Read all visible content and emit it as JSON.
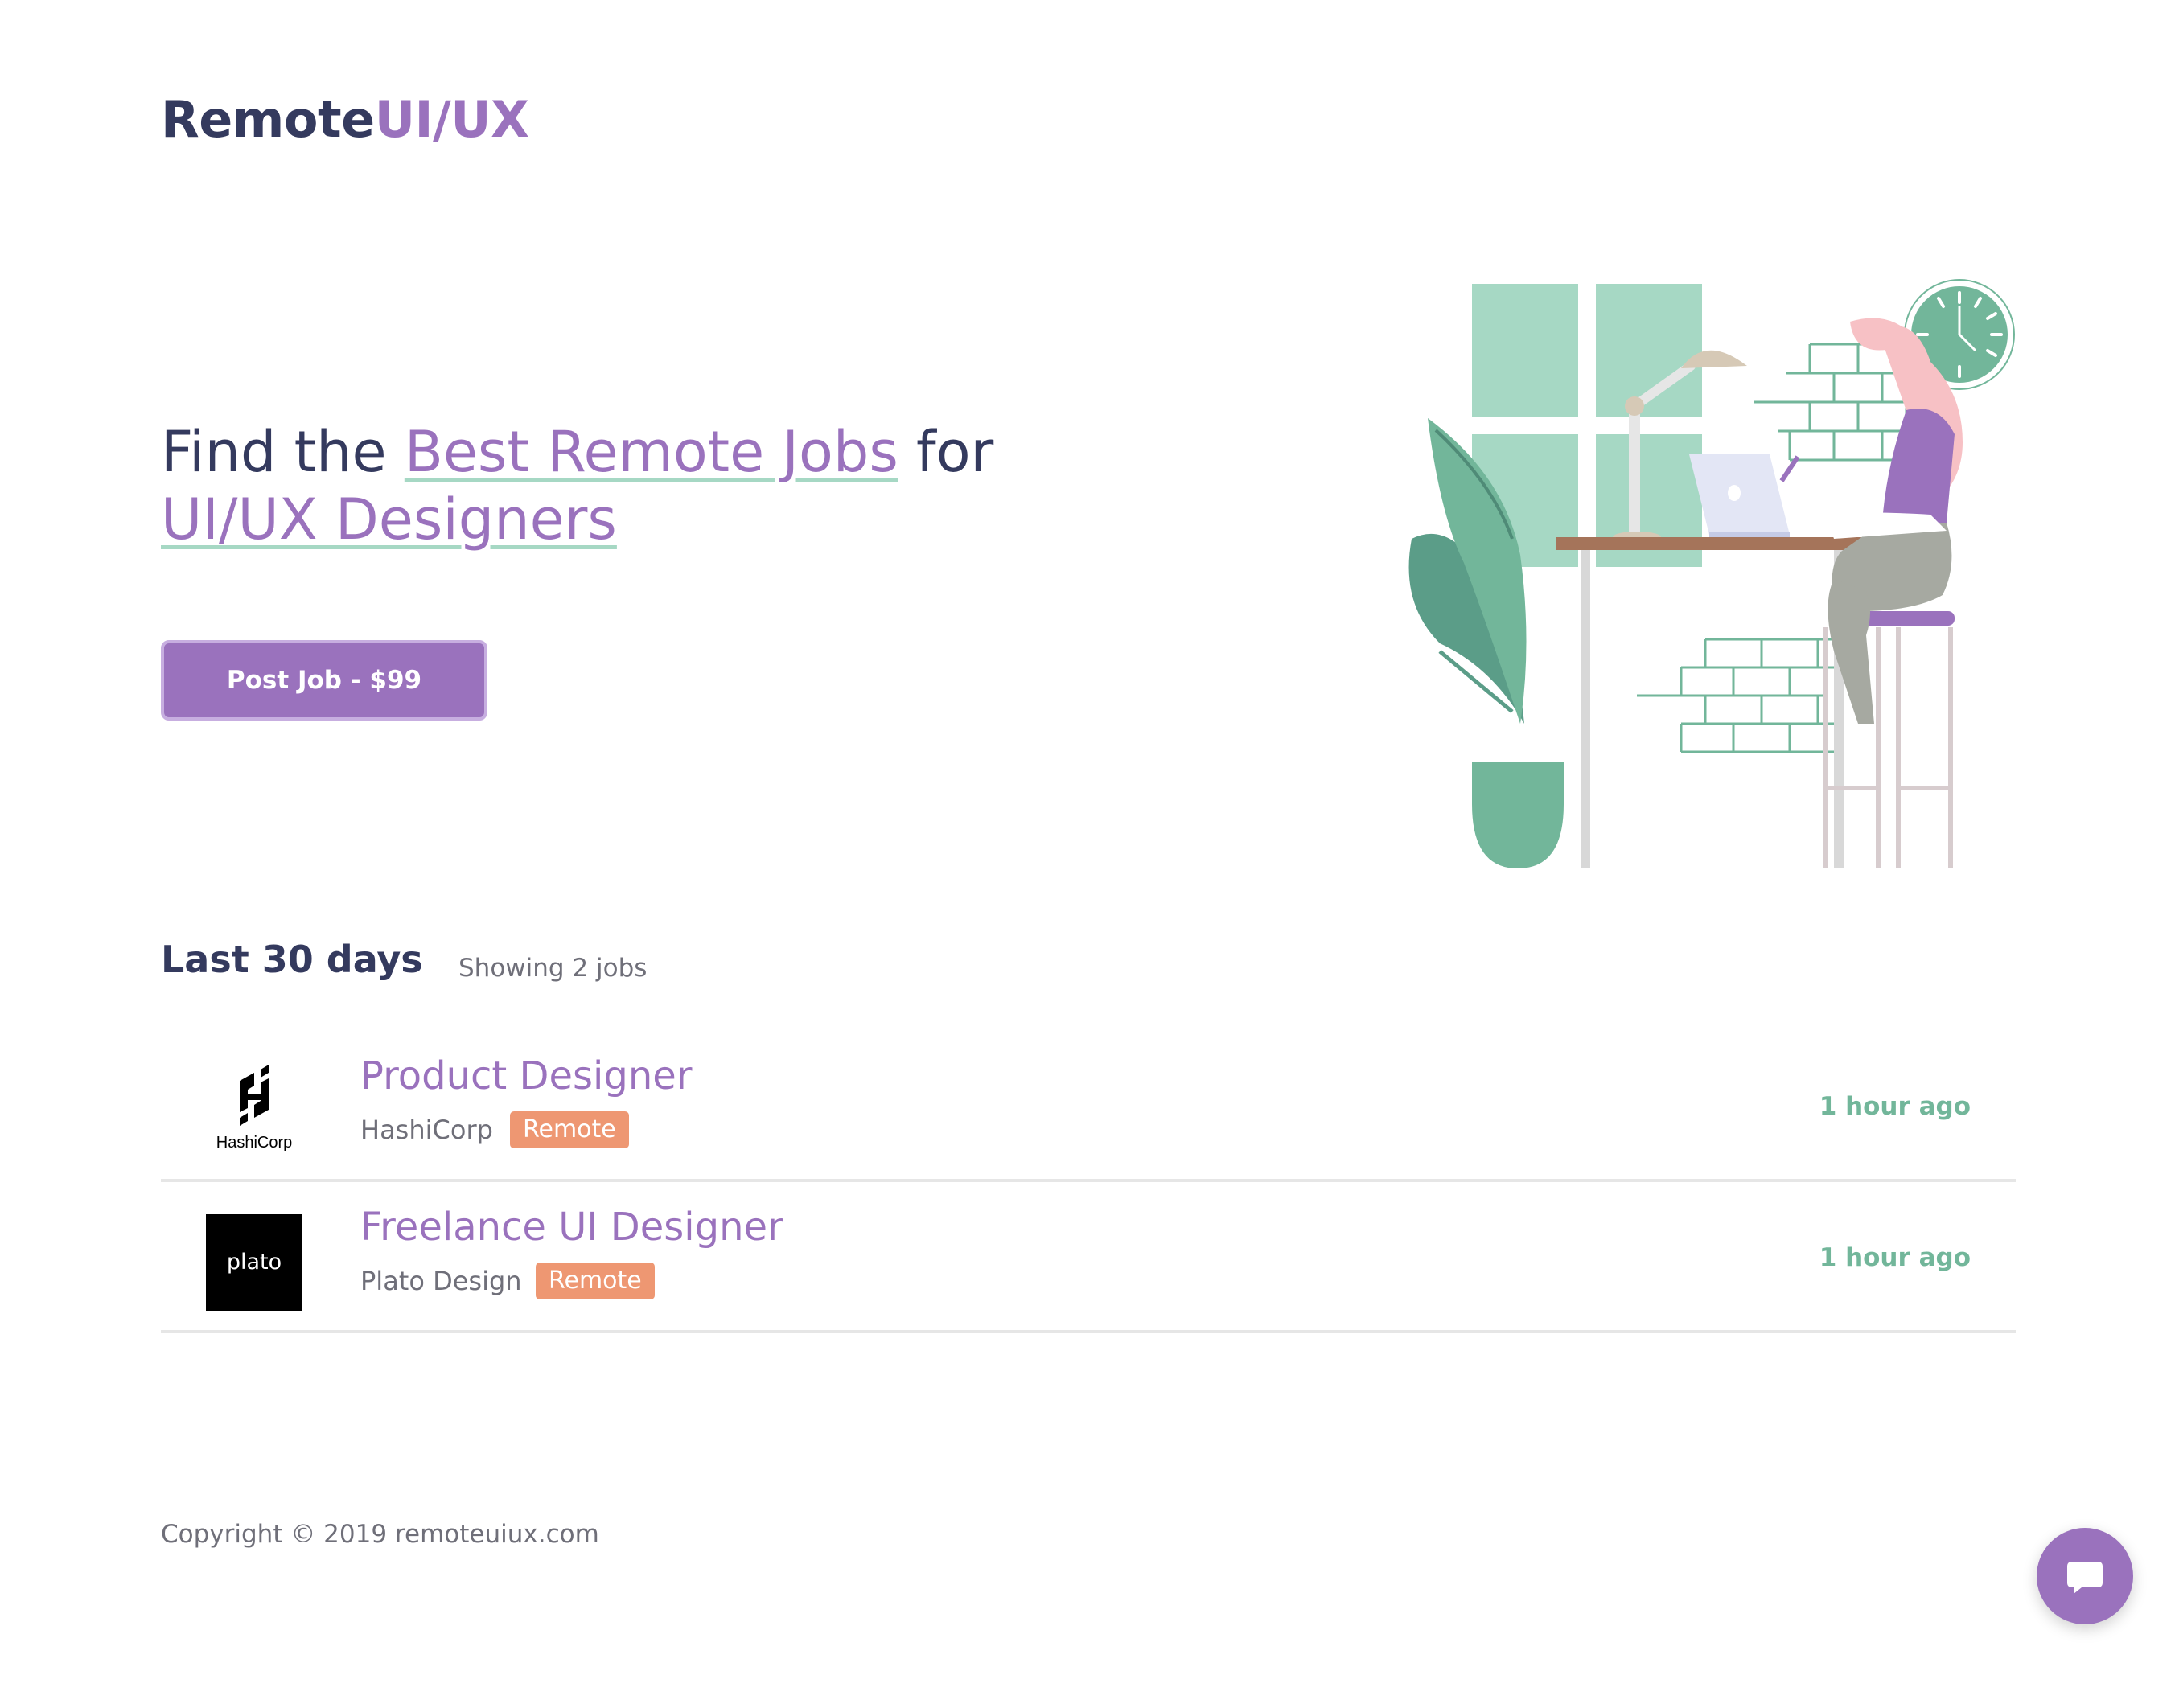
{
  "header": {
    "logo_primary": "Remote",
    "logo_accent": "UI/UX"
  },
  "hero": {
    "heading_part1": "Find the ",
    "heading_highlight1": "Best Remote Jobs",
    "heading_part2": " for ",
    "heading_highlight2": "UI/UX Designers",
    "cta_label": "Post Job - $99",
    "illustration_icon": "remote-worker-illustration"
  },
  "jobs_section": {
    "title": "Last 30 days",
    "count_text": "Showing 2 jobs",
    "jobs": [
      {
        "title": "Product Designer",
        "company": "HashiCorp",
        "tag": "Remote",
        "time_ago": "1 hour ago",
        "logo_text": "HashiCorp",
        "logo_icon": "hashicorp-logo"
      },
      {
        "title": "Freelance UI Designer",
        "company": "Plato Design",
        "tag": "Remote",
        "time_ago": "1 hour ago",
        "logo_text": "plato",
        "logo_icon": "plato-logo"
      }
    ]
  },
  "footer": {
    "copyright": "Copyright © 2019 remoteuiux.com"
  },
  "chat": {
    "icon": "chat-bubble-icon"
  },
  "colors": {
    "brand_purple": "#9a72bd",
    "dark_text": "#343a5e",
    "mint": "#a6d8c4",
    "green_text": "#72b69a",
    "remote_tag": "#ee9772",
    "muted_text": "#6f6f79"
  }
}
